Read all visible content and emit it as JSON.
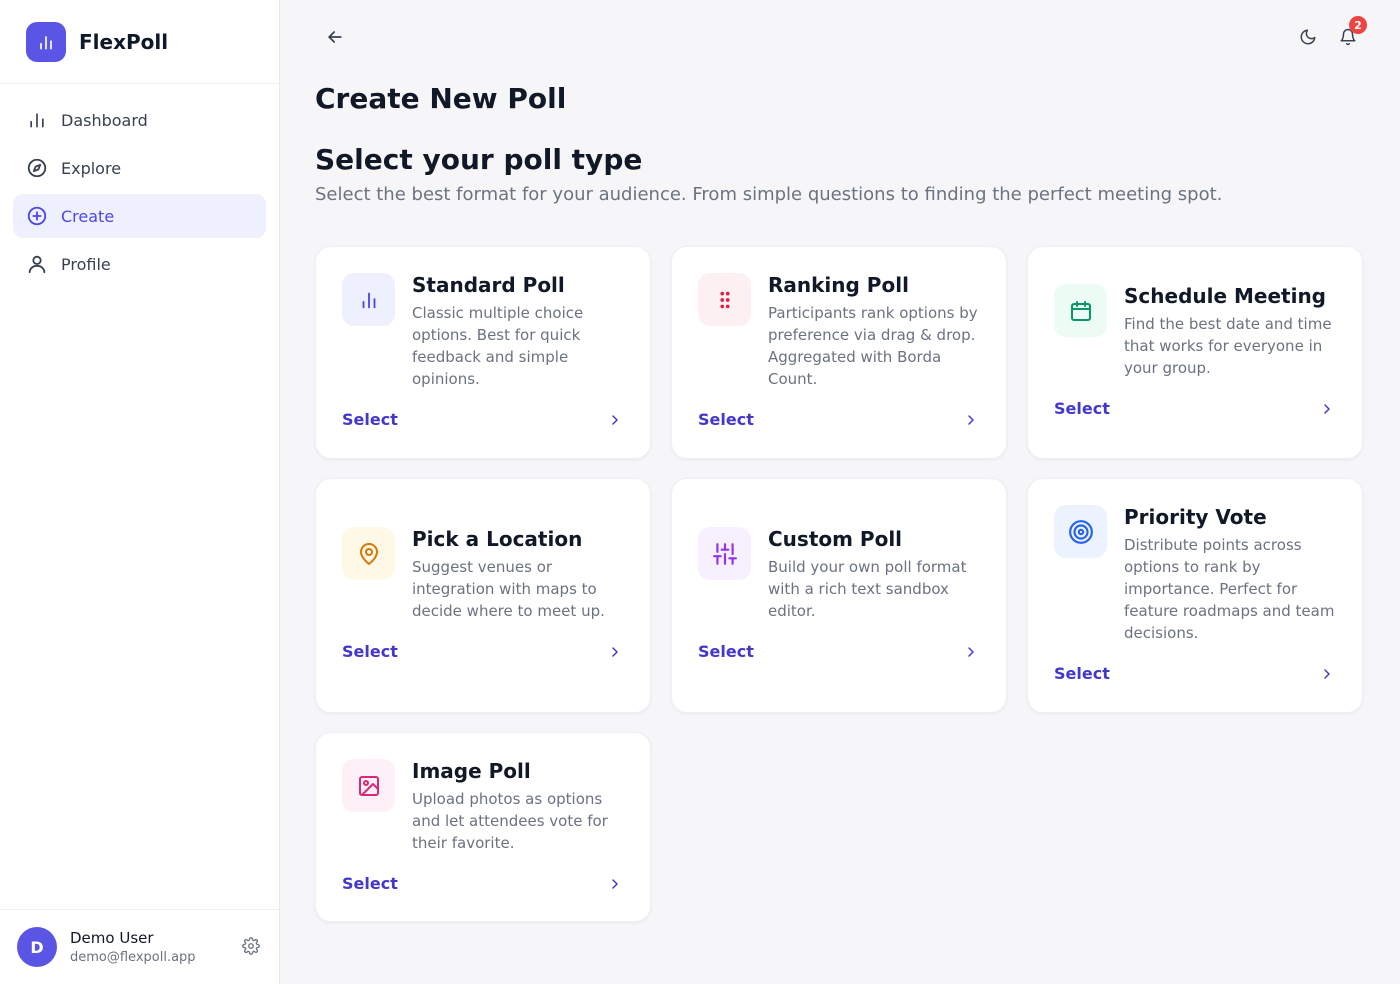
{
  "app": {
    "name": "FlexPoll",
    "accent": "#5b55e6",
    "logo_icon": "bar-chart-icon"
  },
  "nav": {
    "items": [
      {
        "label": "Dashboard",
        "icon": "bar-chart-icon",
        "active": false
      },
      {
        "label": "Explore",
        "icon": "compass-icon",
        "active": false
      },
      {
        "label": "Create",
        "icon": "plus-circle-icon",
        "active": true
      },
      {
        "label": "Profile",
        "icon": "user-icon",
        "active": false
      }
    ]
  },
  "user": {
    "initial": "D",
    "name": "Demo User",
    "email": "demo@flexpoll.app"
  },
  "header": {
    "notification_count": "2"
  },
  "page": {
    "title": "Create New Poll",
    "section_title": "Select your poll type",
    "section_subtitle": "Select the best format for your audience. From simple questions to finding the perfect meeting spot."
  },
  "poll_types": [
    {
      "title": "Standard Poll",
      "description": "Classic multiple choice options. Best for quick feedback and simple opinions.",
      "select_label": "Select",
      "icon": "bar-chart-icon",
      "icon_color": "#4f46e5",
      "icon_bg": "#eef0fd"
    },
    {
      "title": "Ranking Poll",
      "description": "Participants rank options by preference via drag & drop. Aggregated with Borda Count.",
      "select_label": "Select",
      "icon": "grip-dots-icon",
      "icon_color": "#e11d48",
      "icon_bg": "#fdf0f2"
    },
    {
      "title": "Schedule Meeting",
      "description": "Find the best date and time that works for everyone in your group.",
      "select_label": "Select",
      "icon": "calendar-icon",
      "icon_color": "#059669",
      "icon_bg": "#ecfbf3"
    },
    {
      "title": "Pick a Location",
      "description": "Suggest venues or integration with maps to decide where to meet up.",
      "select_label": "Select",
      "icon": "map-pin-icon",
      "icon_color": "#d97706",
      "icon_bg": "#fef8e7"
    },
    {
      "title": "Custom Poll",
      "description": "Build your own poll format with a rich text sandbox editor.",
      "select_label": "Select",
      "icon": "sliders-icon",
      "icon_color": "#9333ea",
      "icon_bg": "#f7f0fe"
    },
    {
      "title": "Priority Vote",
      "description": "Distribute points across options to rank by importance. Perfect for feature roadmaps and team decisions.",
      "select_label": "Select",
      "icon": "target-icon",
      "icon_color": "#2563eb",
      "icon_bg": "#edf3fe"
    },
    {
      "title": "Image Poll",
      "description": "Upload photos as options and let attendees vote for their favorite.",
      "select_label": "Select",
      "icon": "image-icon",
      "icon_color": "#db2777",
      "icon_bg": "#fdf0f6"
    }
  ]
}
